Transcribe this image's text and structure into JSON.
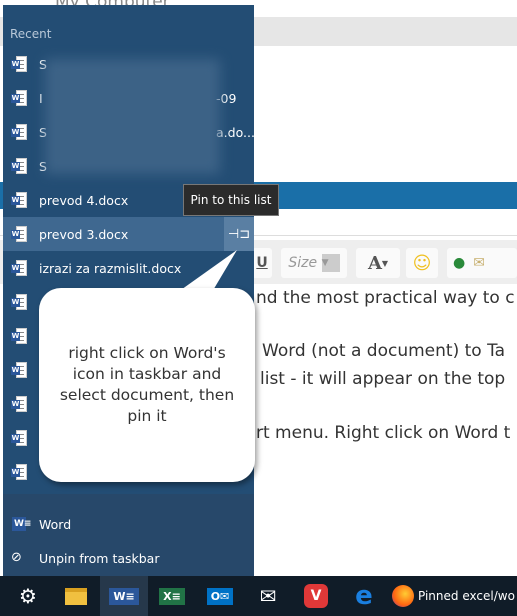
{
  "background": {
    "title": "My Computer",
    "toolbar": {
      "size_label": "Size",
      "font_color": "A"
    },
    "text_lines": [
      "nd the most practical way to c",
      "Word (not a document) to Ta",
      "list - it will appear on the top",
      "rt menu. Right click on Word t"
    ]
  },
  "jumplist": {
    "section_title": "Recent",
    "items": [
      {
        "label": "S",
        "blurred": true
      },
      {
        "label": "I",
        "suffix": "-09",
        "blurred": true
      },
      {
        "label": "S",
        "suffix": "a.do...",
        "blurred": true
      },
      {
        "label": "S",
        "blurred": true
      },
      {
        "label": "prevod 4.docx"
      },
      {
        "label": "prevod 3.docx",
        "hovered": true
      },
      {
        "label": "izrazi za razmislit.docx"
      },
      {
        "label": ""
      },
      {
        "label": ""
      },
      {
        "label": ""
      },
      {
        "label": ""
      },
      {
        "label": ""
      },
      {
        "label": ""
      }
    ],
    "app_label": "Word",
    "unpin_label": "Unpin from taskbar",
    "tooltip": "Pin to this list"
  },
  "callout": {
    "text": "right click on Word's icon in taskbar and select document, then pin it"
  },
  "taskbar": {
    "icons": [
      "gear-icon",
      "file-explorer-icon",
      "word-icon",
      "excel-icon",
      "outlook-icon",
      "mail-icon",
      "vivaldi-icon",
      "edge-icon",
      "firefox-icon"
    ],
    "firefox_label": "Pinned excel/wo"
  },
  "colors": {
    "menu_bg": "#234d74",
    "hover": "#3f6890",
    "taskbar": "#101c28",
    "word": "#2b579a"
  }
}
